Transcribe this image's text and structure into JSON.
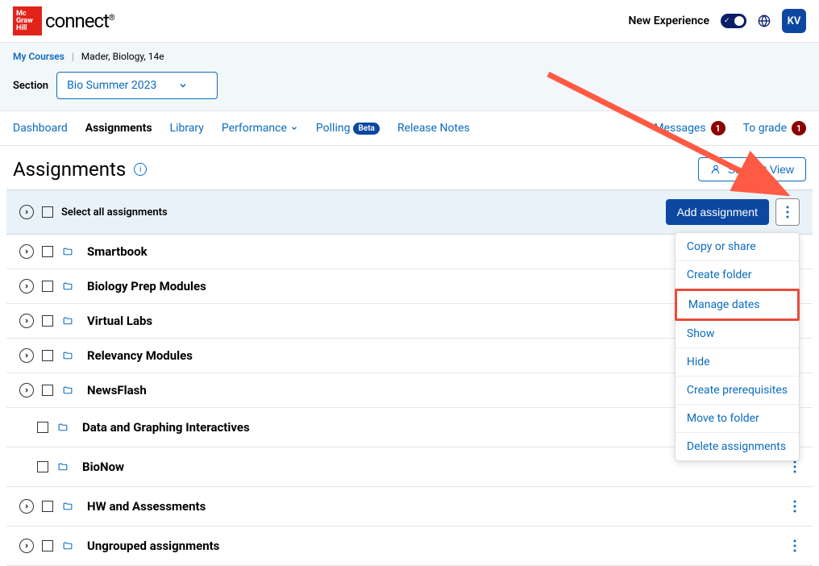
{
  "header": {
    "brand_line1": "Mc",
    "brand_line2": "Graw",
    "brand_line3": "Hill",
    "connect": "connect",
    "new_experience": "New Experience",
    "avatar": "KV"
  },
  "breadcrumb": {
    "my_courses": "My Courses",
    "course": "Mader, Biology, 14e"
  },
  "section": {
    "label": "Section",
    "selected": "Bio Summer 2023"
  },
  "tabs": {
    "dashboard": "Dashboard",
    "assignments": "Assignments",
    "library": "Library",
    "performance": "Performance",
    "polling": "Polling",
    "polling_badge": "Beta",
    "release_notes": "Release Notes"
  },
  "right_links": {
    "messages": "Messages",
    "messages_count": "1",
    "to_grade": "To grade",
    "to_grade_count": "1"
  },
  "page": {
    "title": "Assignments",
    "student_view": "Student View"
  },
  "action_bar": {
    "select_all": "Select all assignments",
    "add_assignment": "Add assignment"
  },
  "menu": {
    "copy_share": "Copy or share",
    "create_folder": "Create folder",
    "manage_dates": "Manage dates",
    "show": "Show",
    "hide": "Hide",
    "create_prereq": "Create prerequisites",
    "move_folder": "Move to folder",
    "delete": "Delete assignments"
  },
  "assignments": [
    {
      "name": "Smartbook",
      "expandable": true,
      "indent": false,
      "kebab": false
    },
    {
      "name": "Biology Prep Modules",
      "expandable": true,
      "indent": false,
      "kebab": false
    },
    {
      "name": "Virtual Labs",
      "expandable": true,
      "indent": false,
      "kebab": false
    },
    {
      "name": "Relevancy Modules",
      "expandable": true,
      "indent": false,
      "kebab": false
    },
    {
      "name": "NewsFlash",
      "expandable": true,
      "indent": false,
      "kebab": false
    },
    {
      "name": "Data and Graphing Interactives",
      "expandable": false,
      "indent": true,
      "kebab": true
    },
    {
      "name": "BioNow",
      "expandable": false,
      "indent": true,
      "kebab": true
    },
    {
      "name": "HW and Assessments",
      "expandable": true,
      "indent": false,
      "kebab": true
    },
    {
      "name": "Ungrouped assignments",
      "expandable": true,
      "indent": false,
      "kebab": true
    }
  ]
}
